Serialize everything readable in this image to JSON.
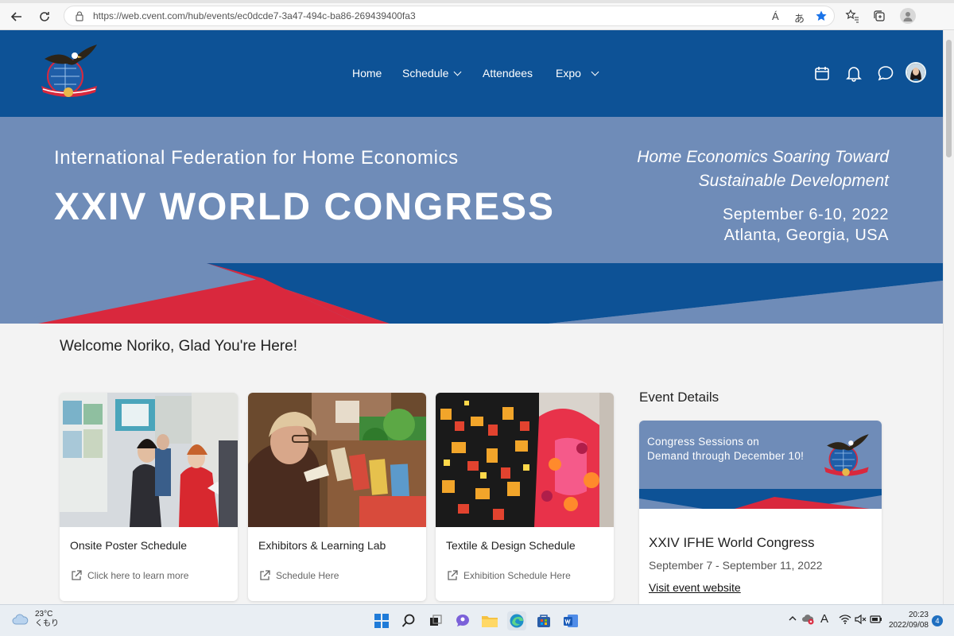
{
  "browser": {
    "url": "https://web.cvent.com/hub/events/ec0dcde7-3a47-494c-ba86-269439400fa3",
    "read_aloud_label": "Á",
    "translate_label": "あ"
  },
  "header": {
    "nav": [
      {
        "label": "Home"
      },
      {
        "label": "Schedule"
      },
      {
        "label": "Attendees"
      },
      {
        "label": "Expo"
      }
    ]
  },
  "banner": {
    "org": "International Federation for Home Economics",
    "congress": "XXIV WORLD CONGRESS",
    "tagline_1": "Home Economics Soaring Toward",
    "tagline_2": "Sustainable Development",
    "dates": "September 6-10, 2022",
    "location": "Atlanta, Georgia, USA"
  },
  "welcome": "Welcome Noriko, Glad You're Here!",
  "cards": [
    {
      "title": "Onsite Poster Schedule",
      "link": "Click here to learn more"
    },
    {
      "title": "Exhibitors & Learning Lab",
      "link": "Schedule Here"
    },
    {
      "title": "Textile & Design Schedule",
      "link": "Exhibition Schedule Here"
    }
  ],
  "event_details": {
    "heading": "Event Details",
    "promo_1": "Congress Sessions on",
    "promo_2": "Demand through December 10!",
    "name": "XXIV IFHE World Congress",
    "dates": "September 7 - September 11, 2022",
    "link": "Visit event website"
  },
  "taskbar": {
    "temperature": "23°C",
    "condition": "くもり",
    "time": "20:23",
    "date": "2022/09/08",
    "notifications": "4",
    "ime_label": "A"
  },
  "colors": {
    "header_blue": "#0d5296",
    "banner_blue": "#6f8cb8",
    "accent_red": "#d9283d",
    "deep_blue": "#0d5296"
  }
}
